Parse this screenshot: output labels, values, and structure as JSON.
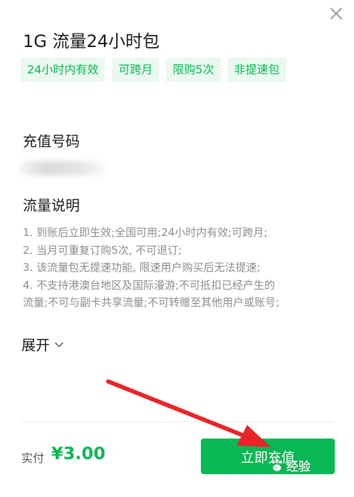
{
  "package": {
    "title": "1G 流量24小时包",
    "tags": [
      "24小时内有效",
      "可跨月",
      "限购5次",
      "非提速包"
    ]
  },
  "recharge_number": {
    "label": "充值号码"
  },
  "description": {
    "label": "流量说明",
    "lines": [
      "1. 到账后立即生效;全国可用;24小时内有效;可跨月;",
      "2. 当月可重复订购5次, 不可退订;",
      "3. 该流量包无提速功能, 限速用户购买后无法提速;",
      "4. 不支持港澳台地区及国际漫游;不可抵扣已经产生的",
      "流量;不可与副卡共享流量;不可转赠至其他用户或账号;"
    ]
  },
  "expand": {
    "label": "展开"
  },
  "footer": {
    "pay_label": "实付",
    "pay_amount": "¥3.00",
    "recharge_button": "立即充值"
  },
  "watermark": {
    "text": "经验"
  },
  "icons": {
    "close": "close-icon",
    "expand": "chevron-down-icon",
    "annotation": "red-arrow-icon"
  },
  "colors": {
    "accent_green": "#08b854",
    "tag_bg": "#eaf8ef",
    "arrow_red": "#e8262a",
    "muted_text": "#8c8c8c"
  }
}
